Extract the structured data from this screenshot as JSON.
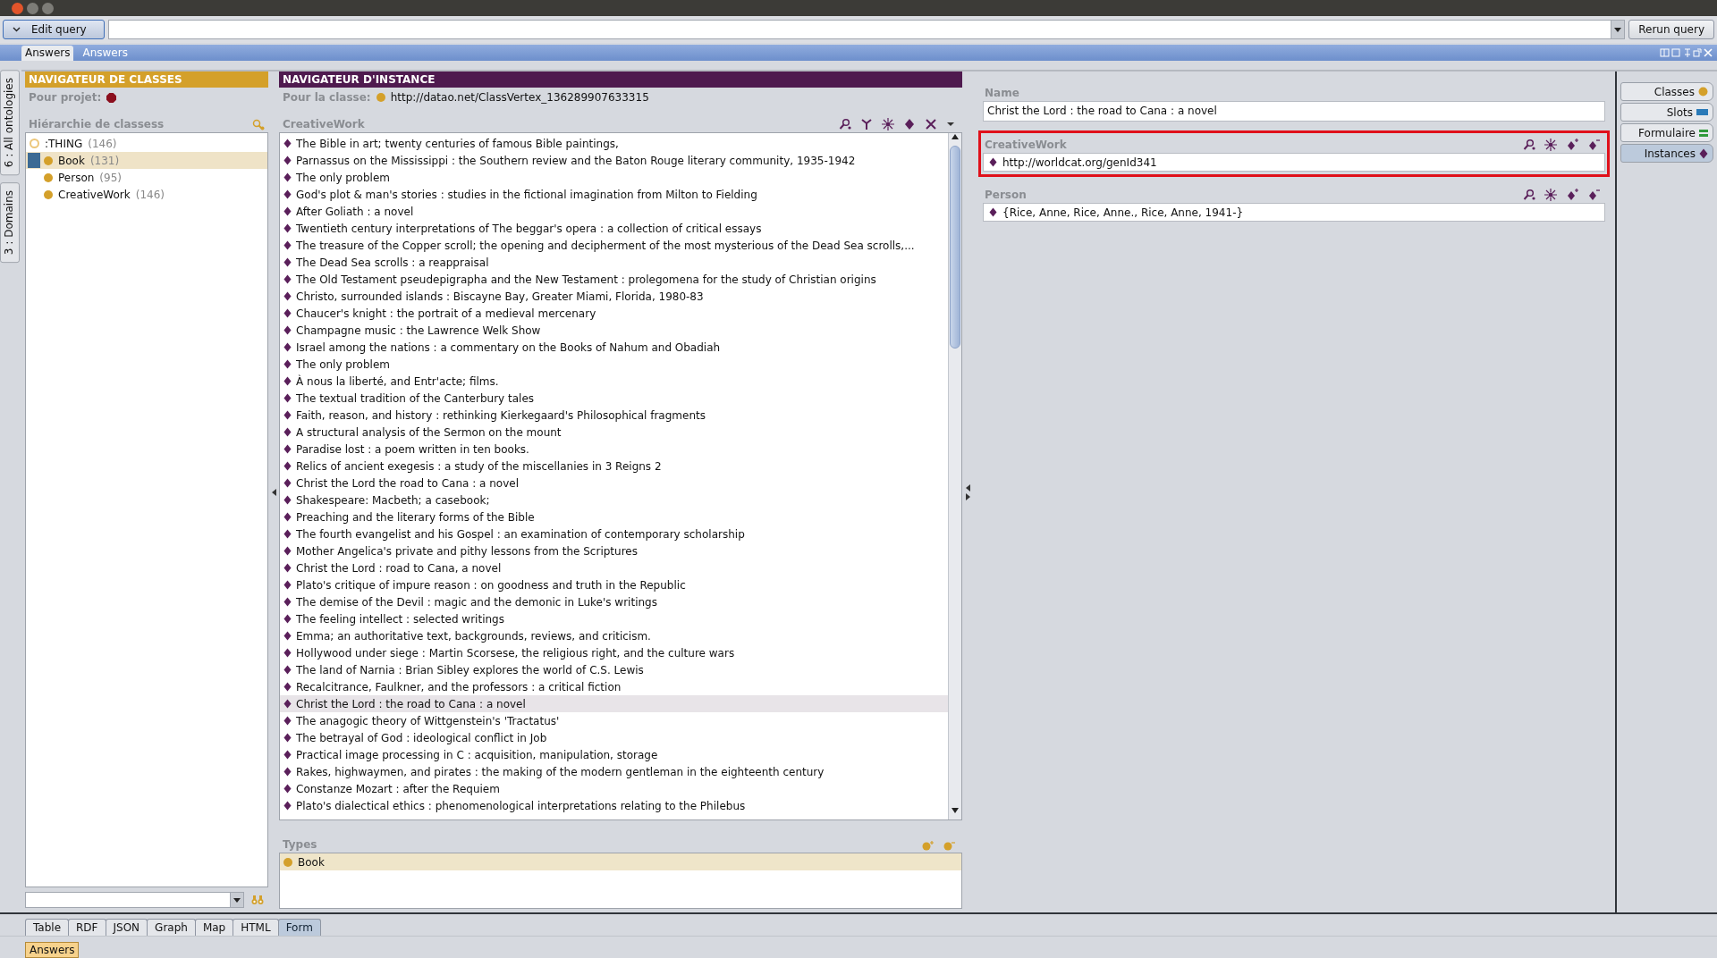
{
  "toolbar": {
    "edit_button": "Edit query",
    "rerun_button": "Rerun query"
  },
  "view_tabs": [
    {
      "label": "Answers",
      "selected": true
    },
    {
      "label": "Answers",
      "selected": false
    }
  ],
  "side_tabs": [
    {
      "label": "6 : All ontologies"
    },
    {
      "label": "3 : Domains"
    }
  ],
  "class_navigator": {
    "title": "NAVIGATEUR DE CLASSES",
    "project_label": "Pour projet:",
    "hierarchy_label": "Hiérarchie de classess",
    "tree": [
      {
        "label": ":THING",
        "count": "(146)",
        "selected": false,
        "children": [
          {
            "label": "Book",
            "count": "(131)",
            "selected": true
          },
          {
            "label": "Person",
            "count": "(95)",
            "selected": false
          },
          {
            "label": "CreativeWork",
            "count": "(146)",
            "selected": false
          }
        ]
      }
    ]
  },
  "instance_navigator": {
    "title": "NAVIGATEUR D'INSTANCE",
    "class_label": "Pour la classe:",
    "class_uri": "http://datao.net/ClassVertex_136289907633315",
    "list_title": "CreativeWork",
    "instances": [
      {
        "label": "The Bible in art; twenty centuries of famous Bible paintings,",
        "selected": false
      },
      {
        "label": "Parnassus on the Mississippi : the Southern review and the Baton Rouge literary community, 1935-1942",
        "selected": false
      },
      {
        "label": "The only problem",
        "selected": false
      },
      {
        "label": "God's plot & man's stories : studies in the fictional imagination from Milton to Fielding",
        "selected": false
      },
      {
        "label": "After Goliath : a novel",
        "selected": false
      },
      {
        "label": "Twentieth century interpretations of The beggar's opera : a collection of critical essays",
        "selected": false
      },
      {
        "label": "The treasure of the Copper scroll; the opening and decipherment of the most mysterious of the Dead Sea scrolls,...",
        "selected": false
      },
      {
        "label": "The Dead Sea scrolls : a reappraisal",
        "selected": false
      },
      {
        "label": "The Old Testament pseudepigrapha and the New Testament : prolegomena for the study of Christian origins",
        "selected": false
      },
      {
        "label": "Christo, surrounded islands : Biscayne Bay, Greater Miami, Florida, 1980-83",
        "selected": false
      },
      {
        "label": "Chaucer's knight : the portrait of a medieval mercenary",
        "selected": false
      },
      {
        "label": "Champagne music : the Lawrence Welk Show",
        "selected": false
      },
      {
        "label": "Israel among the nations : a commentary on the Books of Nahum and Obadiah",
        "selected": false
      },
      {
        "label": "The only problem",
        "selected": false
      },
      {
        "label": "À nous la liberté, and Entr'acte; films.",
        "selected": false
      },
      {
        "label": "The textual tradition of the Canterbury tales",
        "selected": false
      },
      {
        "label": "Faith, reason, and history : rethinking Kierkegaard's Philosophical fragments",
        "selected": false
      },
      {
        "label": "A structural analysis of the Sermon on the mount",
        "selected": false
      },
      {
        "label": "Paradise lost : a poem written in ten books.",
        "selected": false
      },
      {
        "label": "Relics of ancient exegesis : a study of the miscellanies in 3 Reigns 2",
        "selected": false
      },
      {
        "label": "Christ the Lord the road to Cana : a novel",
        "selected": false
      },
      {
        "label": "Shakespeare: Macbeth; a casebook;",
        "selected": false
      },
      {
        "label": "Preaching and the literary forms of the Bible",
        "selected": false
      },
      {
        "label": "The fourth evangelist and his Gospel : an examination of contemporary scholarship",
        "selected": false
      },
      {
        "label": "Mother Angelica's private and pithy lessons from the Scriptures",
        "selected": false
      },
      {
        "label": "Christ the Lord : road to Cana, a novel",
        "selected": false
      },
      {
        "label": "Plato's critique of impure reason : on goodness and truth in the Republic",
        "selected": false
      },
      {
        "label": "The demise of the Devil : magic and the demonic in Luke's writings",
        "selected": false
      },
      {
        "label": "The feeling intellect : selected writings",
        "selected": false
      },
      {
        "label": "Emma; an authoritative text, backgrounds, reviews, and criticism.",
        "selected": false
      },
      {
        "label": "Hollywood under siege : Martin Scorsese, the religious right, and the culture wars",
        "selected": false
      },
      {
        "label": "The land of Narnia : Brian Sibley explores the world of C.S. Lewis",
        "selected": false
      },
      {
        "label": "Recalcitrance, Faulkner, and the professors : a critical fiction",
        "selected": false
      },
      {
        "label": "Christ the Lord : the road to Cana : a novel",
        "selected": true
      },
      {
        "label": "The anagogic theory of Wittgenstein's 'Tractatus'",
        "selected": false
      },
      {
        "label": "The betrayal of God : ideological conflict in Job",
        "selected": false
      },
      {
        "label": "Practical image processing in C : acquisition, manipulation, storage",
        "selected": false
      },
      {
        "label": "Rakes, highwaymen, and pirates : the making of the modern gentleman in the eighteenth century",
        "selected": false
      },
      {
        "label": "Constanze Mozart : after the Requiem",
        "selected": false
      },
      {
        "label": "Plato's dialectical ethics : phenomenological interpretations relating to the Philebus",
        "selected": false
      }
    ],
    "types_label": "Types",
    "types": [
      {
        "label": "Book",
        "selected": true
      }
    ]
  },
  "form": {
    "fields": [
      {
        "label": "Name",
        "kind": "text",
        "value": "Christ the Lord : the road to Cana : a novel",
        "highlighted": false
      },
      {
        "label": "CreativeWork",
        "kind": "instances",
        "values": [
          "http://worldcat.org/genId341"
        ],
        "highlighted": true
      },
      {
        "label": "Person",
        "kind": "instances",
        "values": [
          "{Rice, Anne, Rice, Anne., Rice, Anne, 1941-}"
        ],
        "highlighted": false
      }
    ]
  },
  "right_tabs": [
    {
      "label": "Classes",
      "selected": false
    },
    {
      "label": "Slots",
      "selected": false
    },
    {
      "label": "Formulaire",
      "selected": false
    },
    {
      "label": "Instances",
      "selected": true
    }
  ],
  "bottom_tabs": [
    {
      "label": "Table",
      "selected": false
    },
    {
      "label": "RDF",
      "selected": false
    },
    {
      "label": "JSON",
      "selected": false
    },
    {
      "label": "Graph",
      "selected": false
    },
    {
      "label": "Map",
      "selected": false
    },
    {
      "label": "HTML",
      "selected": false
    },
    {
      "label": "Form",
      "selected": true
    }
  ],
  "status_tab": "Answers"
}
